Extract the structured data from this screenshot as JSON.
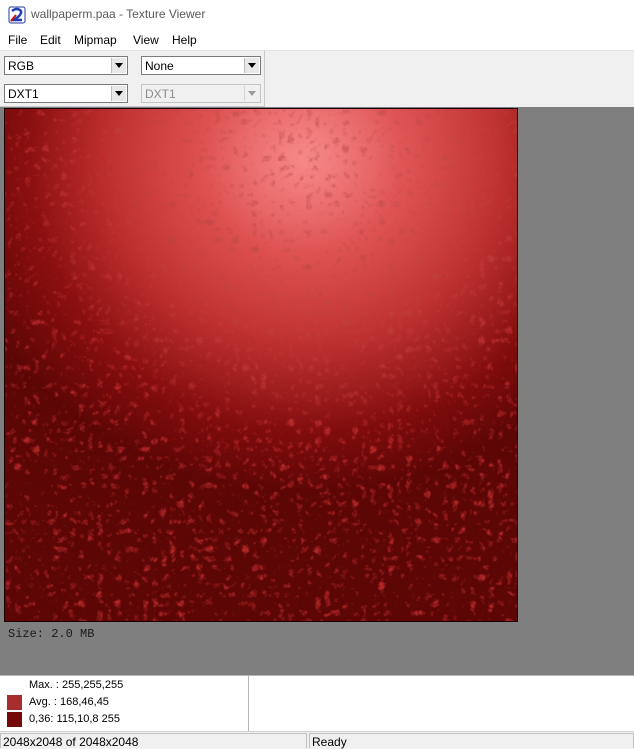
{
  "window": {
    "title": "wallpaperm.paa - Texture Viewer"
  },
  "menu": [
    "File",
    "Edit",
    "Mipmap",
    "View",
    "Help"
  ],
  "toolbar": {
    "channel": "RGB",
    "filter": "None",
    "format": "DXT1",
    "format_secondary": "DXT1"
  },
  "viewer": {
    "size_label": "Size: 2.0 MB"
  },
  "stats": [
    {
      "label": "Max.",
      "value": ": 255,255,255",
      "color": "#ffffff"
    },
    {
      "label": "Avg.",
      "value": ": 168,46,45",
      "color": "#a82e2d"
    },
    {
      "label": "0,36:",
      "value": "115,10,8  255",
      "color": "#730a08"
    }
  ],
  "status": {
    "dimensions": "2048x2048 of 2048x2048",
    "state": "Ready"
  },
  "colors": {
    "texture_accent": "#c42424"
  },
  "icons": {
    "app": "app-icon",
    "dropdown": "chevron-down-icon"
  }
}
